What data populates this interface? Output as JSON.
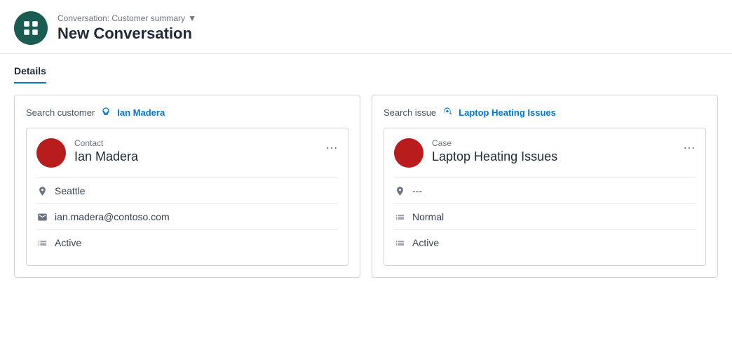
{
  "header": {
    "subtitle": "Conversation: Customer summary",
    "chevron": "▾",
    "title": "New Conversation"
  },
  "tabs": {
    "details_label": "Details"
  },
  "customer_panel": {
    "search_label": "Search customer",
    "search_value": "Ian Madera",
    "card": {
      "type": "Contact",
      "name": "Ian Madera",
      "fields": [
        {
          "icon": "location",
          "value": "Seattle"
        },
        {
          "icon": "email",
          "value": "ian.madera@contoso.com"
        },
        {
          "icon": "status",
          "value": "Active"
        }
      ]
    }
  },
  "issue_panel": {
    "search_label": "Search issue",
    "search_value": "Laptop Heating Issues",
    "card": {
      "type": "Case",
      "name": "Laptop Heating Issues",
      "fields": [
        {
          "icon": "id",
          "value": "---"
        },
        {
          "icon": "priority",
          "value": "Normal"
        },
        {
          "icon": "status",
          "value": "Active"
        }
      ]
    }
  }
}
